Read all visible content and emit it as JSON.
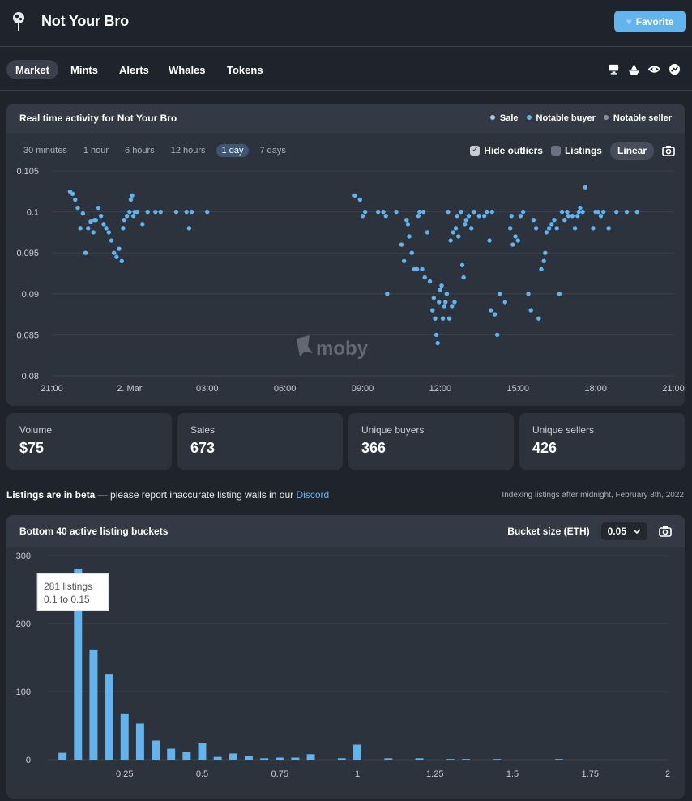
{
  "header": {
    "title": "Not Your Bro",
    "favorite_label": "Favorite"
  },
  "nav": {
    "tabs": [
      {
        "label": "Market",
        "active": true
      },
      {
        "label": "Mints"
      },
      {
        "label": "Alerts"
      },
      {
        "label": "Whales"
      },
      {
        "label": "Tokens"
      }
    ],
    "icons": [
      "desktop-icon",
      "ship-icon",
      "eye-icon",
      "chart-icon"
    ]
  },
  "activity": {
    "title": "Real time activity for Not Your Bro",
    "legend": [
      {
        "label": "Sale",
        "color": "#a9c7e6"
      },
      {
        "label": "Notable buyer",
        "color": "#63b3ed"
      },
      {
        "label": "Notable seller",
        "color": "#8a919c"
      }
    ],
    "ranges": [
      "30 minutes",
      "1 hour",
      "6 hours",
      "12 hours",
      "1 day",
      "7 days"
    ],
    "active_range": "1 day",
    "hide_outliers_label": "Hide outliers",
    "hide_outliers_checked": true,
    "listings_label": "Listings",
    "scale_label": "Linear",
    "watermark": "moby"
  },
  "stats": [
    {
      "label": "Volume",
      "value": "$75"
    },
    {
      "label": "Sales",
      "value": "673"
    },
    {
      "label": "Unique buyers",
      "value": "366"
    },
    {
      "label": "Unique sellers",
      "value": "426"
    }
  ],
  "beta_notice": {
    "bold": "Listings are in beta",
    "text": " — please report inaccurate listing walls in our ",
    "link": "Discord",
    "indexing": "Indexing listings after midnight, February 8th, 2022"
  },
  "buckets": {
    "title": "Bottom 40 active listing buckets",
    "bucket_size_label": "Bucket size (ETH)",
    "bucket_size_value": "0.05",
    "tooltip_count": "281 listings",
    "tooltip_range": "0.1 to 0.15"
  },
  "chart_data": [
    {
      "type": "scatter",
      "title": "Real time activity for Not Your Bro",
      "x_tick_labels": [
        "21:00",
        "2. Mar",
        "03:00",
        "06:00",
        "09:00",
        "12:00",
        "15:00",
        "18:00",
        "21:00"
      ],
      "x_tick_hours": [
        0,
        3,
        6,
        9,
        12,
        15,
        18,
        21,
        24
      ],
      "y_ticks": [
        0.105,
        0.1,
        0.095,
        0.09,
        0.085,
        0.08
      ],
      "y_tick_labels": [
        "0.105",
        "0.1",
        "0.095",
        "0.09",
        "0.085",
        "0.08"
      ],
      "ylim": [
        0.08,
        0.105
      ],
      "xlim_hours": [
        0,
        24
      ],
      "series": [
        {
          "name": "Sale",
          "points": [
            [
              0.7,
              0.1025
            ],
            [
              0.8,
              0.1022
            ],
            [
              0.9,
              0.1015
            ],
            [
              1.0,
              0.1005
            ],
            [
              1.1,
              0.098
            ],
            [
              1.2,
              0.0998
            ],
            [
              1.3,
              0.095
            ],
            [
              1.4,
              0.098
            ],
            [
              1.5,
              0.0988
            ],
            [
              1.6,
              0.0975
            ],
            [
              1.65,
              0.099
            ],
            [
              1.7,
              0.099
            ],
            [
              1.8,
              0.1005
            ],
            [
              1.9,
              0.0995
            ],
            [
              2.0,
              0.0985
            ],
            [
              2.1,
              0.098
            ],
            [
              2.2,
              0.0975
            ],
            [
              2.3,
              0.0965
            ],
            [
              2.4,
              0.095
            ],
            [
              2.5,
              0.0945
            ],
            [
              2.6,
              0.0955
            ],
            [
              2.7,
              0.094
            ],
            [
              2.75,
              0.098
            ],
            [
              2.8,
              0.099
            ],
            [
              2.9,
              0.0995
            ],
            [
              3.0,
              0.1
            ],
            [
              3.05,
              0.1015
            ],
            [
              3.1,
              0.102
            ],
            [
              3.15,
              0.0995
            ],
            [
              3.2,
              0.1
            ],
            [
              3.3,
              0.1
            ],
            [
              3.5,
              0.0985
            ],
            [
              3.7,
              0.1
            ],
            [
              4.0,
              0.1
            ],
            [
              4.2,
              0.1
            ],
            [
              4.8,
              0.1
            ],
            [
              5.2,
              0.1
            ],
            [
              5.3,
              0.098
            ],
            [
              5.4,
              0.1
            ],
            [
              6.0,
              0.1
            ],
            [
              11.7,
              0.102
            ],
            [
              11.9,
              0.1015
            ],
            [
              12.0,
              0.0995
            ],
            [
              12.1,
              0.1
            ],
            [
              12.6,
              0.1
            ],
            [
              12.8,
              0.1
            ],
            [
              12.9,
              0.0995
            ],
            [
              12.95,
              0.09
            ],
            [
              13.3,
              0.1
            ],
            [
              13.5,
              0.096
            ],
            [
              13.6,
              0.094
            ],
            [
              13.7,
              0.099
            ],
            [
              13.75,
              0.0985
            ],
            [
              13.8,
              0.097
            ],
            [
              13.9,
              0.095
            ],
            [
              14.0,
              0.093
            ],
            [
              14.1,
              0.093
            ],
            [
              14.15,
              0.0995
            ],
            [
              14.2,
              0.1
            ],
            [
              14.3,
              0.093
            ],
            [
              14.35,
              0.1
            ],
            [
              14.4,
              0.092
            ],
            [
              14.5,
              0.0975
            ],
            [
              14.6,
              0.0915
            ],
            [
              14.7,
              0.088
            ],
            [
              14.75,
              0.0895
            ],
            [
              14.8,
              0.087
            ],
            [
              14.85,
              0.085
            ],
            [
              14.9,
              0.084
            ],
            [
              14.95,
              0.089
            ],
            [
              15.0,
              0.0905
            ],
            [
              15.05,
              0.091
            ],
            [
              15.1,
              0.087
            ],
            [
              15.15,
              0.0885
            ],
            [
              15.2,
              0.089
            ],
            [
              15.25,
              0.09
            ],
            [
              15.3,
              0.1
            ],
            [
              15.35,
              0.087
            ],
            [
              15.4,
              0.0965
            ],
            [
              15.45,
              0.0885
            ],
            [
              15.5,
              0.0975
            ],
            [
              15.55,
              0.089
            ],
            [
              15.6,
              0.098
            ],
            [
              15.65,
              0.0995
            ],
            [
              15.7,
              0.097
            ],
            [
              15.8,
              0.1
            ],
            [
              15.85,
              0.0935
            ],
            [
              15.9,
              0.092
            ],
            [
              15.95,
              0.0985
            ],
            [
              16.0,
              0.099
            ],
            [
              16.1,
              0.0995
            ],
            [
              16.2,
              0.098
            ],
            [
              16.3,
              0.1
            ],
            [
              16.5,
              0.0995
            ],
            [
              16.7,
              0.0995
            ],
            [
              16.8,
              0.1
            ],
            [
              16.9,
              0.0965
            ],
            [
              16.95,
              0.088
            ],
            [
              17.0,
              0.1
            ],
            [
              17.1,
              0.0875
            ],
            [
              17.2,
              0.085
            ],
            [
              17.3,
              0.09
            ],
            [
              17.5,
              0.089
            ],
            [
              17.7,
              0.098
            ],
            [
              17.75,
              0.0995
            ],
            [
              17.8,
              0.096
            ],
            [
              17.9,
              0.097
            ],
            [
              18.0,
              0.0965
            ],
            [
              18.1,
              0.0995
            ],
            [
              18.2,
              0.1
            ],
            [
              18.4,
              0.09
            ],
            [
              18.5,
              0.088
            ],
            [
              18.6,
              0.099
            ],
            [
              18.7,
              0.098
            ],
            [
              18.8,
              0.087
            ],
            [
              18.9,
              0.093
            ],
            [
              19.0,
              0.094
            ],
            [
              19.05,
              0.095
            ],
            [
              19.1,
              0.0975
            ],
            [
              19.2,
              0.098
            ],
            [
              19.3,
              0.0985
            ],
            [
              19.4,
              0.099
            ],
            [
              19.5,
              0.098
            ],
            [
              19.6,
              0.09
            ],
            [
              19.7,
              0.1
            ],
            [
              19.8,
              0.099
            ],
            [
              19.9,
              0.1
            ],
            [
              19.95,
              0.0995
            ],
            [
              20.1,
              0.0995
            ],
            [
              20.2,
              0.098
            ],
            [
              20.3,
              0.0995
            ],
            [
              20.35,
              0.1
            ],
            [
              20.4,
              0.1005
            ],
            [
              20.5,
              0.1
            ],
            [
              20.6,
              0.103
            ],
            [
              20.9,
              0.098
            ],
            [
              21.0,
              0.1
            ],
            [
              21.1,
              0.1
            ],
            [
              21.2,
              0.0995
            ],
            [
              21.3,
              0.1
            ],
            [
              21.5,
              0.098
            ],
            [
              21.8,
              0.1
            ],
            [
              22.2,
              0.1
            ],
            [
              22.6,
              0.1
            ]
          ]
        }
      ]
    },
    {
      "type": "bar",
      "title": "Bottom 40 active listing buckets",
      "xlabel": "",
      "ylabel": "",
      "x_ticks": [
        0.25,
        0.5,
        0.75,
        1,
        1.25,
        1.5,
        1.75,
        2
      ],
      "x_tick_labels": [
        "0.25",
        "0.5",
        "0.75",
        "1",
        "1.25",
        "1.5",
        "1.75",
        "2"
      ],
      "y_ticks": [
        0,
        100,
        200,
        300
      ],
      "y_tick_labels": [
        "0",
        "100",
        "200",
        "300"
      ],
      "ylim": [
        0,
        300
      ],
      "xlim": [
        0,
        2
      ],
      "bucket_width": 0.05,
      "bars": [
        {
          "x": 0.05,
          "value": 10
        },
        {
          "x": 0.1,
          "value": 281
        },
        {
          "x": 0.15,
          "value": 162
        },
        {
          "x": 0.2,
          "value": 126
        },
        {
          "x": 0.25,
          "value": 68
        },
        {
          "x": 0.3,
          "value": 53
        },
        {
          "x": 0.35,
          "value": 28
        },
        {
          "x": 0.4,
          "value": 16
        },
        {
          "x": 0.45,
          "value": 11
        },
        {
          "x": 0.5,
          "value": 24
        },
        {
          "x": 0.55,
          "value": 4
        },
        {
          "x": 0.6,
          "value": 9
        },
        {
          "x": 0.65,
          "value": 5
        },
        {
          "x": 0.7,
          "value": 2
        },
        {
          "x": 0.75,
          "value": 3
        },
        {
          "x": 0.8,
          "value": 3
        },
        {
          "x": 0.85,
          "value": 8
        },
        {
          "x": 0.95,
          "value": 2
        },
        {
          "x": 1.0,
          "value": 22
        },
        {
          "x": 1.1,
          "value": 2
        },
        {
          "x": 1.2,
          "value": 2
        },
        {
          "x": 1.3,
          "value": 1
        },
        {
          "x": 1.35,
          "value": 1
        },
        {
          "x": 1.45,
          "value": 1
        },
        {
          "x": 1.65,
          "value": 1
        }
      ]
    }
  ]
}
